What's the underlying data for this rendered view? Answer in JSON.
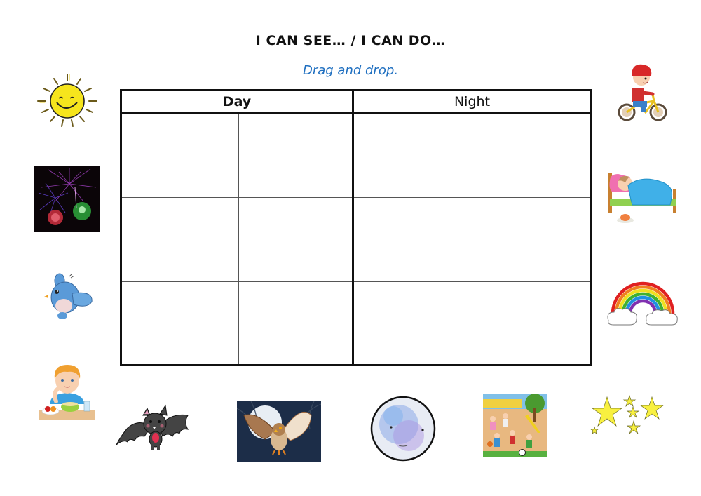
{
  "header": {
    "title": "I CAN SEE… / I CAN DO…",
    "instruction": "Drag and drop."
  },
  "board": {
    "columns": [
      {
        "label": "Day",
        "slots": 6
      },
      {
        "label": "Night",
        "slots": 6
      }
    ],
    "rows": 3,
    "cells_per_column_group": 2
  },
  "cards": [
    {
      "id": "sun",
      "label": "Smiling sun"
    },
    {
      "id": "fireworks",
      "label": "Fireworks"
    },
    {
      "id": "bird",
      "label": "Blue bird"
    },
    {
      "id": "boy-eating",
      "label": "Boy eating breakfast"
    },
    {
      "id": "bat",
      "label": "Bat"
    },
    {
      "id": "owl",
      "label": "Owl flying under the moon"
    },
    {
      "id": "moon",
      "label": "Full moon"
    },
    {
      "id": "playground",
      "label": "Children playing in the park"
    },
    {
      "id": "stars",
      "label": "Stars"
    },
    {
      "id": "rainbow",
      "label": "Rainbow"
    },
    {
      "id": "sleeping",
      "label": "Child sleeping in bed"
    },
    {
      "id": "bike",
      "label": "Boy riding a bike"
    }
  ],
  "colors": {
    "instruction": "#1f6fc0",
    "grid": "#111111"
  }
}
